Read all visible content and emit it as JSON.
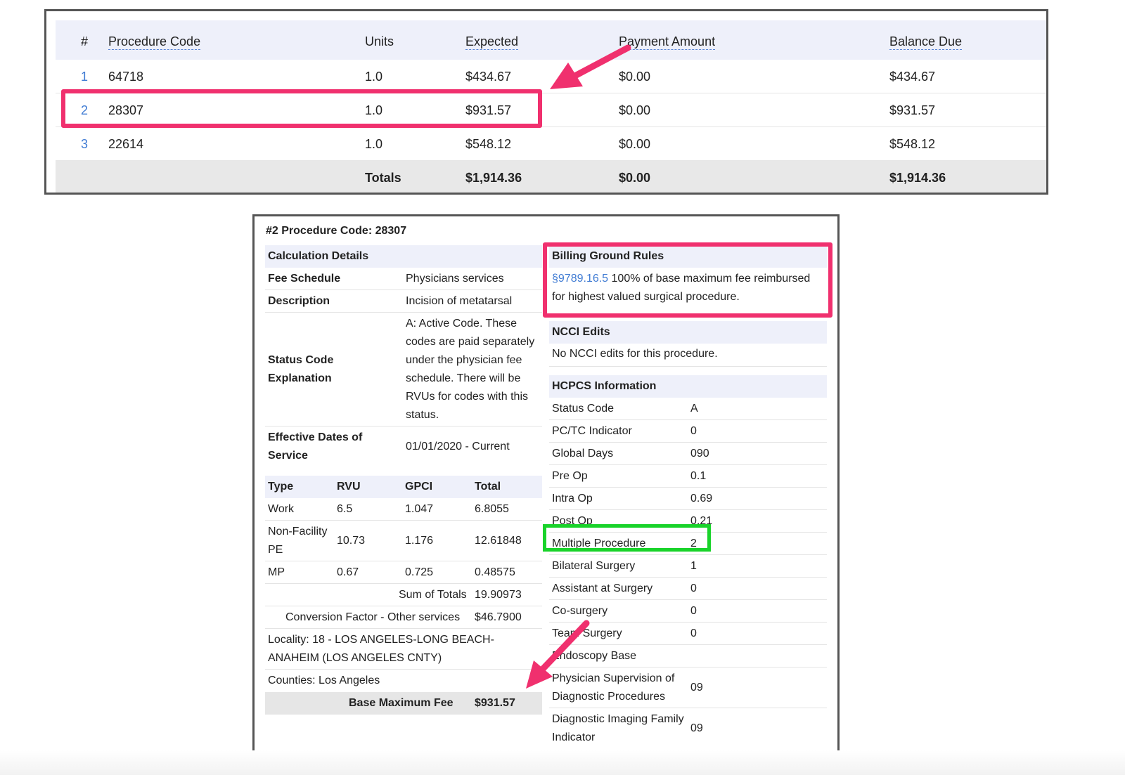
{
  "summary": {
    "headers": {
      "num": "#",
      "procedure_code": "Procedure Code",
      "units": "Units",
      "expected": "Expected",
      "payment_amount": "Payment Amount",
      "balance_due": "Balance Due"
    },
    "rows": [
      {
        "num": "1",
        "code": "64718",
        "units": "1.0",
        "expected": "$434.67",
        "payment": "$0.00",
        "balance": "$434.67"
      },
      {
        "num": "2",
        "code": "28307",
        "units": "1.0",
        "expected": "$931.57",
        "payment": "$0.00",
        "balance": "$931.57"
      },
      {
        "num": "3",
        "code": "22614",
        "units": "1.0",
        "expected": "$548.12",
        "payment": "$0.00",
        "balance": "$548.12"
      }
    ],
    "totals": {
      "label": "Totals",
      "expected": "$1,914.36",
      "payment": "$0.00",
      "balance": "$1,914.36"
    }
  },
  "detail": {
    "title": "#2 Procedure Code: 28307",
    "calc": {
      "heading": "Calculation Details",
      "fee_schedule_label": "Fee Schedule",
      "fee_schedule_value": "Physicians services",
      "description_label": "Description",
      "description_value": "Incision of metatarsal",
      "status_label": "Status Code Explanation",
      "status_value": "A: Active Code. These codes are paid separately under the physician fee schedule. There will be RVUs for codes with this status.",
      "effective_label": "Effective Dates of Service",
      "effective_value": "01/01/2020 - Current"
    },
    "rvu": {
      "headers": [
        "Type",
        "RVU",
        "GPCI",
        "Total"
      ],
      "rows": [
        {
          "type": "Work",
          "rvu": "6.5",
          "gpci": "1.047",
          "total": "6.8055"
        },
        {
          "type": "Non-Facility PE",
          "rvu": "10.73",
          "gpci": "1.176",
          "total": "12.61848"
        },
        {
          "type": "MP",
          "rvu": "0.67",
          "gpci": "0.725",
          "total": "0.48575"
        }
      ],
      "sum_label": "Sum of Totals",
      "sum_value": "19.90973",
      "conversion_label": "Conversion Factor - Other services",
      "conversion_value": "$46.7900",
      "locality": "Locality: 18 - LOS ANGELES-LONG BEACH-ANAHEIM (LOS ANGELES CNTY)",
      "counties": "Counties: Los Angeles",
      "base_label": "Base Maximum Fee",
      "base_value": "$931.57"
    },
    "billing": {
      "heading": "Billing Ground Rules",
      "link": "§9789.16.5",
      "text": " 100% of base maximum fee reimbursed for highest valued surgical procedure."
    },
    "ncci": {
      "heading": "NCCI Edits",
      "text": "No NCCI edits for this procedure."
    },
    "hcpcs": {
      "heading": "HCPCS Information",
      "rows": [
        {
          "label": "Status Code",
          "value": "A"
        },
        {
          "label": "PC/TC Indicator",
          "value": "0"
        },
        {
          "label": "Global Days",
          "value": "090"
        },
        {
          "label": "Pre Op",
          "value": "0.1"
        },
        {
          "label": "Intra Op",
          "value": "0.69"
        },
        {
          "label": "Post Op",
          "value": "0.21"
        },
        {
          "label": "Multiple Procedure",
          "value": "2"
        },
        {
          "label": "Bilateral Surgery",
          "value": "1"
        },
        {
          "label": "Assistant at Surgery",
          "value": "0"
        },
        {
          "label": "Co-surgery",
          "value": "0"
        },
        {
          "label": "Team Surgery",
          "value": "0"
        },
        {
          "label": "Endoscopy Base",
          "value": ""
        },
        {
          "label": "Physician Supervision of Diagnostic Procedures",
          "value": "09"
        },
        {
          "label": "Diagnostic Imaging Family Indicator",
          "value": "09"
        }
      ]
    }
  },
  "colors": {
    "highlight_pink": "#f0306e",
    "highlight_green": "#19d32a",
    "link_blue": "#3f7bd3",
    "header_bg": "#eef0fa"
  }
}
